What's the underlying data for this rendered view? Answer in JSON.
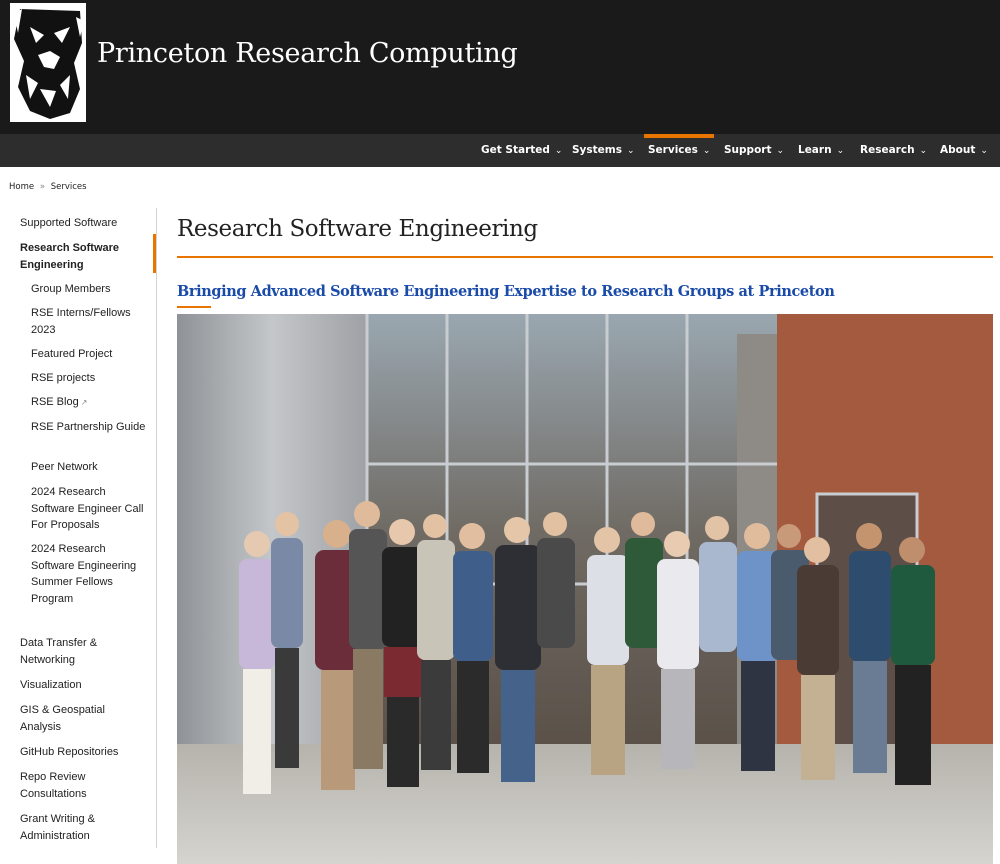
{
  "header": {
    "site_title": "Princeton Research Computing"
  },
  "nav": {
    "items": [
      {
        "label": "Get Started"
      },
      {
        "label": "Systems"
      },
      {
        "label": "Services"
      },
      {
        "label": "Support"
      },
      {
        "label": "Learn"
      },
      {
        "label": "Research"
      },
      {
        "label": "About"
      }
    ],
    "active": "Services"
  },
  "breadcrumb": {
    "home": "Home",
    "sep": "»",
    "current": "Services"
  },
  "sidebar": {
    "items": [
      {
        "label": "Supported Software"
      },
      {
        "label": "Research Software Engineering"
      },
      {
        "label": "Group Members"
      },
      {
        "label": "RSE Interns/Fellows 2023"
      },
      {
        "label": "Featured Project"
      },
      {
        "label": "RSE projects"
      },
      {
        "label": "RSE Blog"
      },
      {
        "label": "RSE Partnership Guide"
      },
      {
        "label": "Peer Network"
      },
      {
        "label": "2024 Research Software Engineer Call For Proposals"
      },
      {
        "label": "2024 Research Software Engineering Summer Fellows Program"
      },
      {
        "label": "Data Transfer & Networking"
      },
      {
        "label": "Visualization"
      },
      {
        "label": "GIS & Geospatial Analysis"
      },
      {
        "label": "GitHub Repositories"
      },
      {
        "label": "Repo Review Consultations"
      },
      {
        "label": "Grant Writing & Administration"
      }
    ]
  },
  "main": {
    "title": "Research Software Engineering",
    "subtitle": "Bringing Advanced Software Engineering Expertise to Research Groups at Princeton"
  },
  "colors": {
    "accent": "#e77500",
    "link": "#1a4ba8",
    "header_bg": "#1a1a1a",
    "nav_bg": "#2d2d2d"
  },
  "icons": {
    "logo": "tiger-shield-logo",
    "nav_chevron": "chevron-down-icon",
    "external": "external-link-icon"
  }
}
